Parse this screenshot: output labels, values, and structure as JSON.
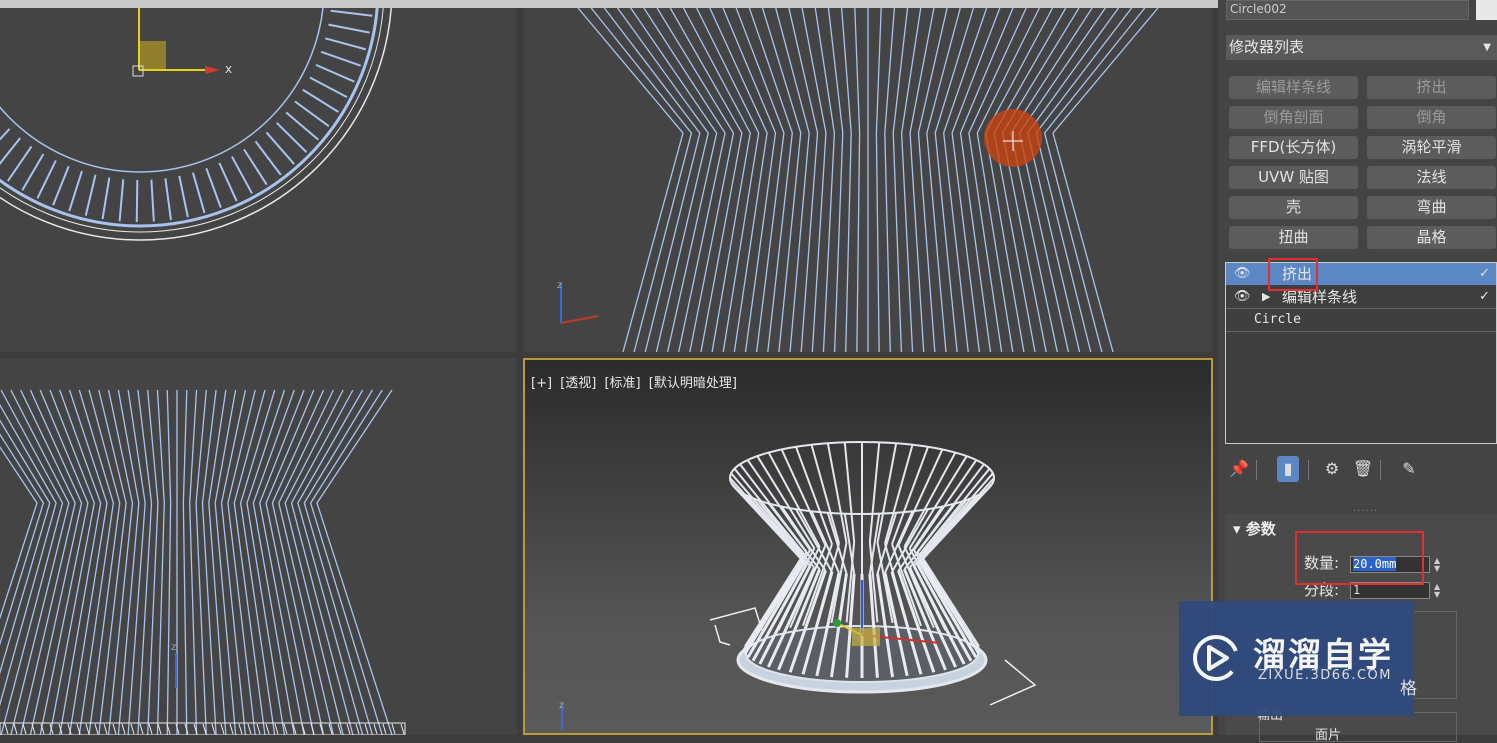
{
  "viewports": {
    "perspective_label": [
      "[+]",
      "[透视]",
      "[标准]",
      "[默认明暗处理]"
    ],
    "top_axis_x": "x",
    "axis_z": "z"
  },
  "panel": {
    "object_name": "Circle002",
    "modifier_list": "修改器列表",
    "buttons": [
      {
        "label": "编辑样条线",
        "dim": true
      },
      {
        "label": "挤出",
        "dim": true
      },
      {
        "label": "倒角剖面",
        "dim": true
      },
      {
        "label": "倒角",
        "dim": true
      },
      {
        "label": "FFD(长方体)",
        "dim": false
      },
      {
        "label": "涡轮平滑",
        "dim": false
      },
      {
        "label": "UVW 贴图",
        "dim": false
      },
      {
        "label": "法线",
        "dim": false
      },
      {
        "label": "壳",
        "dim": false
      },
      {
        "label": "弯曲",
        "dim": false
      },
      {
        "label": "扭曲",
        "dim": false
      },
      {
        "label": "晶格",
        "dim": false
      }
    ],
    "stack": [
      {
        "label": "挤出",
        "selected": true
      },
      {
        "label": "编辑样条线",
        "selected": false
      },
      {
        "label": "Circle",
        "selected": false
      }
    ],
    "params_title": "参数",
    "amount_label": "数量:",
    "amount_value": "20.0mm",
    "segments_label": "分段:",
    "segments_value": "1",
    "partial_label_1": "输出",
    "partial_label_2": "面片",
    "partial_label_3": "格"
  },
  "watermark": {
    "title": "溜溜自学",
    "subtitle": "ZIXUE.3D66.COM"
  },
  "colors": {
    "wire": "#a7c4f0",
    "selection": "#5b87c4",
    "highlight_box": "#e03030",
    "active_viewport": "#b89a3c"
  }
}
